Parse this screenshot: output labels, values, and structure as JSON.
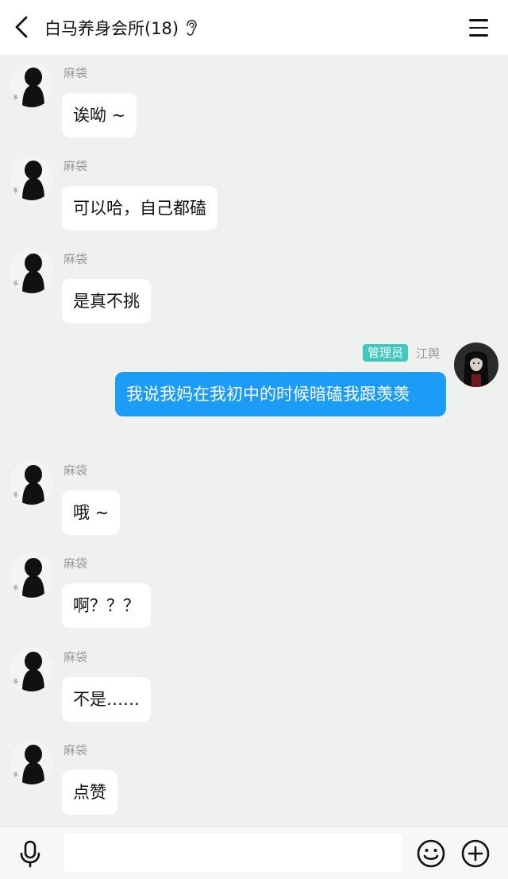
{
  "header": {
    "title": "白马养身会所(18)",
    "back_icon": "chevron-left-icon",
    "ear_icon": "ear-icon",
    "menu_icon": "hamburger-menu-icon"
  },
  "messages": [
    {
      "sender": "麻袋",
      "text": "诶呦 ~",
      "self": false
    },
    {
      "sender": "麻袋",
      "text": "可以哈，自己都磕",
      "self": false
    },
    {
      "sender": "麻袋",
      "text": "是真不挑",
      "self": false
    },
    {
      "sender": "江舆",
      "badge": "管理员",
      "text": "我说我妈在我初中的时候暗磕我跟羡羡",
      "self": true
    },
    {
      "sender": "麻袋",
      "text": "哦 ~",
      "self": false
    },
    {
      "sender": "麻袋",
      "text": "啊？？？",
      "self": false
    },
    {
      "sender": "麻袋",
      "text": "不是……",
      "self": false
    },
    {
      "sender": "麻袋",
      "text": "点赞",
      "self": false
    }
  ],
  "input_bar": {
    "placeholder": "",
    "value": "",
    "mic_icon": "microphone-icon",
    "emoji_icon": "smiley-icon",
    "plus_icon": "plus-circle-icon"
  },
  "colors": {
    "background": "#eef1ee",
    "self_bubble": "#1a9cf7",
    "admin_badge": "#3ec9bf"
  }
}
